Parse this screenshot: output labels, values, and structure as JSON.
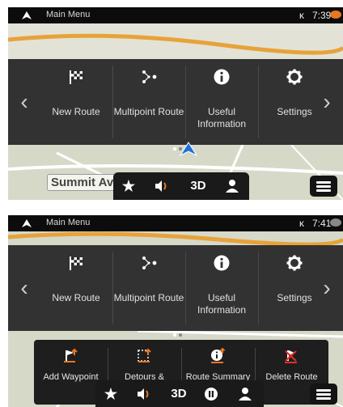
{
  "status": {
    "title": "Main Menu",
    "time_top": "7:39",
    "time_bottom": "7:41",
    "gps": "ĸ"
  },
  "menu": {
    "items": [
      {
        "label": "New Route",
        "icon": "checkered-flag-icon"
      },
      {
        "label": "Multipoint Route",
        "icon": "multipoint-route-icon"
      },
      {
        "label": "Useful Information",
        "icon": "info-icon"
      },
      {
        "label": "Settings",
        "icon": "gear-icon"
      }
    ]
  },
  "map": {
    "street": "Summit Av"
  },
  "bottom_bar": {
    "mode_label": "3D"
  },
  "route_menu": {
    "items": [
      {
        "label": "Add Waypoint",
        "icon": "add-waypoint-icon"
      },
      {
        "label": "Detours & Alternatives",
        "icon": "detour-icon"
      },
      {
        "label": "Route Summary",
        "icon": "route-summary-icon"
      },
      {
        "label": "Delete Route",
        "icon": "delete-route-icon"
      }
    ]
  },
  "colors": {
    "accent": "#e87722",
    "menu_bg": "#323232",
    "bar_bg": "#0c0c0c"
  }
}
